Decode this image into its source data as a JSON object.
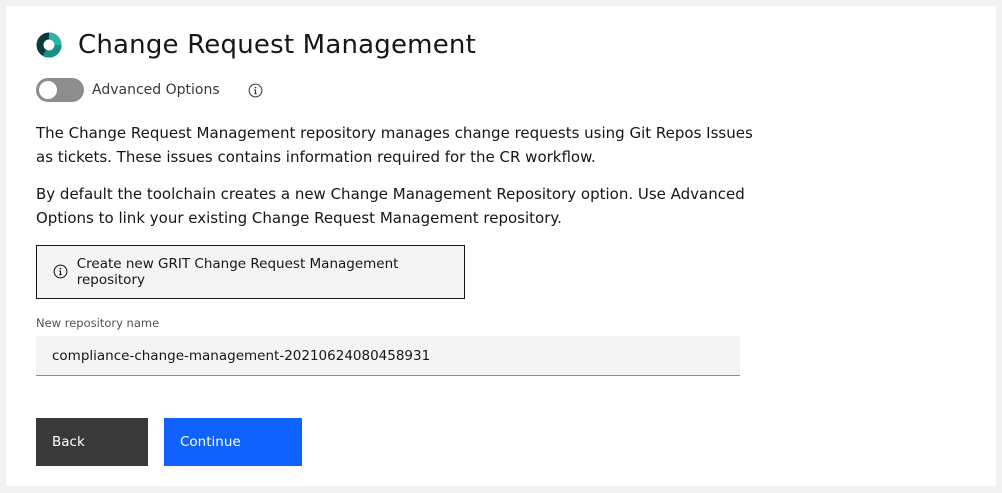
{
  "header": {
    "title": "Change Request Management"
  },
  "toggle": {
    "label": "Advanced Options",
    "state": "off"
  },
  "description": {
    "paragraph1": "The Change Request Management repository manages change requests using Git Repos Issues as tickets. These issues contains information required for the CR workflow.",
    "paragraph2": "By default the toolchain creates a new Change Management Repository option. Use Advanced Options to link your existing Change Request Management repository."
  },
  "notice": {
    "text": "Create new GRIT Change Request Management repository"
  },
  "repo_field": {
    "label": "New repository name",
    "value": "compliance-change-management-20210624080458931"
  },
  "actions": {
    "back_label": "Back",
    "continue_label": "Continue"
  },
  "colors": {
    "primary": "#0f62fe",
    "secondary": "#393939",
    "toggle_off": "#8d8d8d",
    "logo_teal": "#198d8a",
    "logo_dark": "#0b3b3a"
  },
  "icons": {
    "logo": "ring-logo-icon",
    "info": "info-icon"
  }
}
